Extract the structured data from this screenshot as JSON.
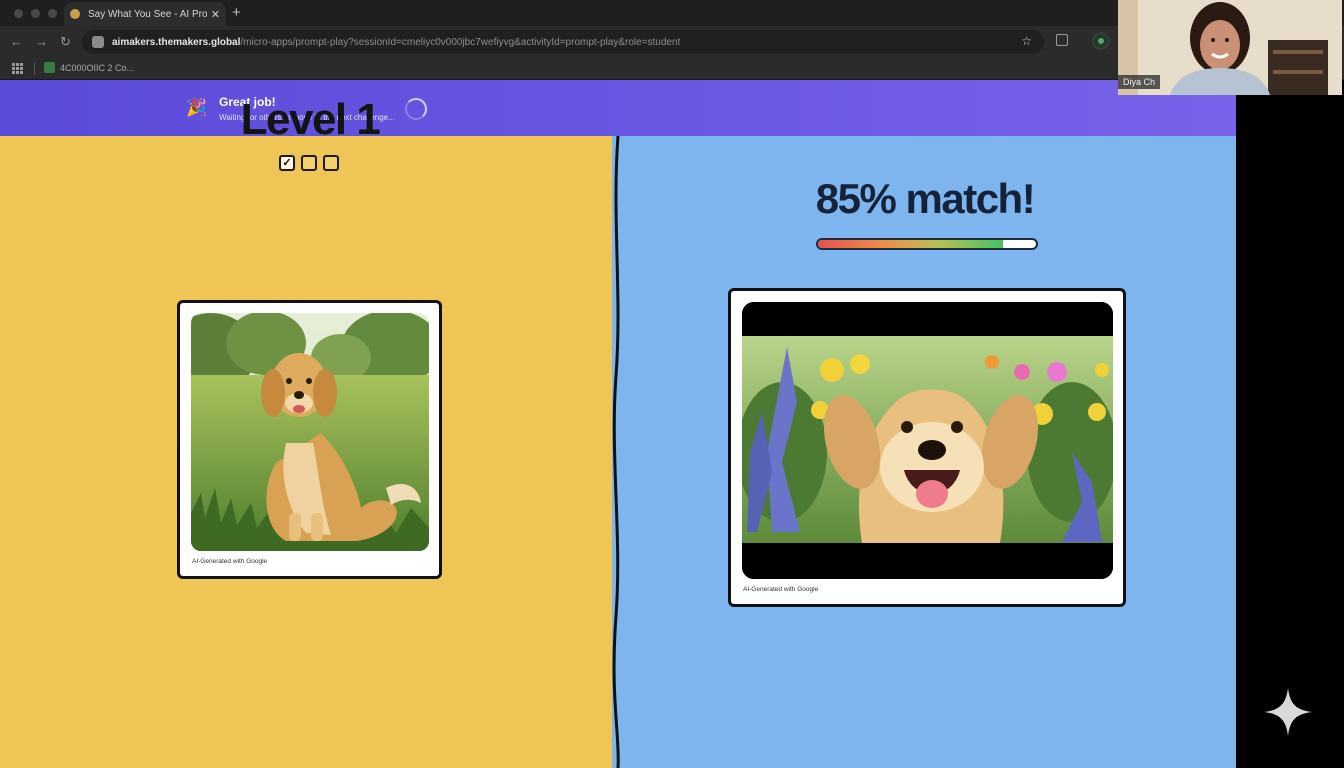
{
  "browser": {
    "tab_title": "Say What You See - AI Prompt",
    "tab_close": "✕",
    "new_tab": "+",
    "url_host": "aimakers.themakers.global",
    "url_path": "/micro-apps/prompt-play?sessionId=cmeliyc0v000jbc7wefiyvg&activityId=prompt-play&role=student",
    "bookmark_label": "4C000OIIC 2 Co..."
  },
  "banner": {
    "title": "Great job!",
    "subtitle": "Waiting for others to move to the next challenge..."
  },
  "level": {
    "title": "Level 1",
    "boxes": [
      {
        "label": "✓",
        "checked": true
      },
      {
        "label": "",
        "checked": false
      },
      {
        "label": "",
        "checked": false
      }
    ]
  },
  "left_card": {
    "caption": "AI-Generated with Google"
  },
  "result": {
    "match_text": "85% match!",
    "match_percent": 85
  },
  "right_card": {
    "caption": "AI-Generated with Google"
  },
  "video_call": {
    "participant_name": "Diya Ch"
  },
  "icons": {
    "spinner": "loading-spinner-icon",
    "party": "party-popper-icon",
    "sparkle": "sparkle-icon"
  },
  "colors": {
    "banner": "#6a58e3",
    "left_panel": "#efc556",
    "right_panel": "#7eb5ef"
  }
}
